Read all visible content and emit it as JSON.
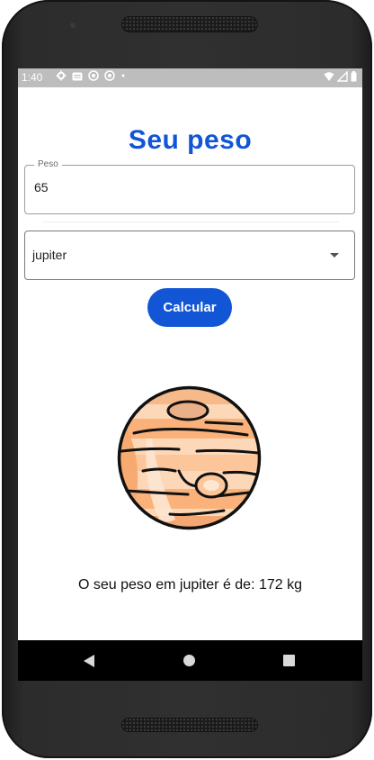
{
  "status_bar": {
    "time": "1:40",
    "icons_left": [
      "settings-icon",
      "sim-card-icon",
      "sync-icon",
      "sync-icon",
      "dot-icon"
    ],
    "icons_right": [
      "wifi-icon",
      "signal-icon",
      "battery-icon"
    ]
  },
  "app": {
    "title": "Seu peso",
    "weight_field": {
      "label": "Peso",
      "value": "65"
    },
    "planet_select": {
      "selected": "jupiter"
    },
    "calculate_button": "Calcular",
    "planet_image": "jupiter-illustration",
    "result_text": "O seu peso em jupiter é de: 172 kg"
  },
  "nav_bar": {
    "buttons": [
      "back-icon",
      "home-icon",
      "recents-icon"
    ]
  },
  "colors": {
    "accent": "#1256d6",
    "status_bar": "#bdbdbd",
    "nav_bar": "#000000",
    "planet_light": "#fdd8b8",
    "planet_mid": "#fbb27a",
    "planet_dark": "#e8a26b"
  }
}
